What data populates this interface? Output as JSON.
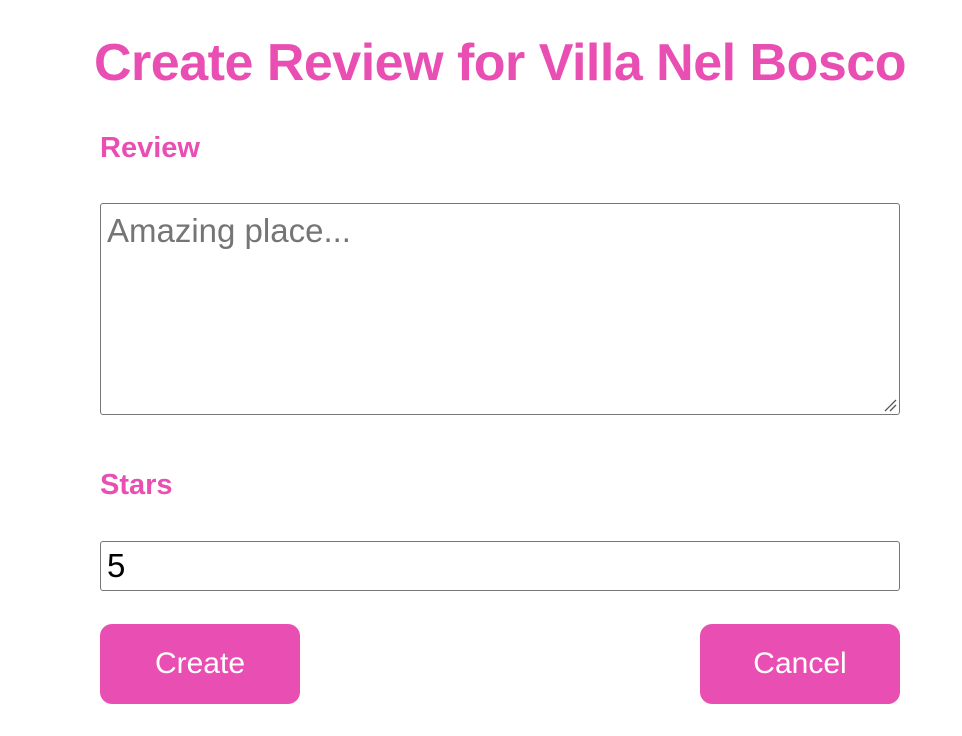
{
  "page": {
    "title": "Create Review for Villa Nel Bosco"
  },
  "form": {
    "review": {
      "label": "Review",
      "placeholder": "Amazing place...",
      "value": ""
    },
    "stars": {
      "label": "Stars",
      "value": "5"
    },
    "buttons": {
      "create_label": "Create",
      "cancel_label": "Cancel"
    }
  },
  "theme": {
    "accent": "#e94fb3",
    "button_text": "#ffffff",
    "input_border": "#767676",
    "placeholder_text": "#757575"
  },
  "icons": {
    "resize_handle": "resize-grip-icon"
  }
}
